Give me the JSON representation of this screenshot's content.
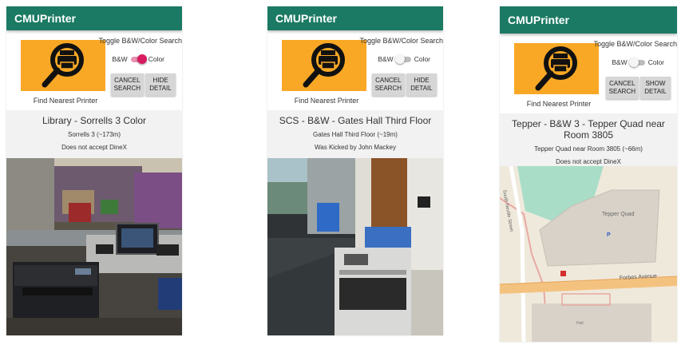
{
  "screens": [
    {
      "app_title": "CMUPrinter",
      "find_label": "Find Nearest Printer",
      "toggle_title": "Toggle B&W/Color Search",
      "bw_label": "B&W",
      "color_label": "Color",
      "toggle_state": "Color",
      "cancel_label": "CANCEL\nSEARCH",
      "detail_label": "HIDE\nDETAIL",
      "printer_name": "Library - Sorrells 3 Color",
      "location": "Sorrells 3 (~173m)",
      "note": "Does not accept DineX",
      "image": "photo of color printer near library desk"
    },
    {
      "app_title": "CMUPrinter",
      "find_label": "Find Nearest Printer",
      "toggle_title": "Toggle B&W/Color Search",
      "bw_label": "B&W",
      "color_label": "Color",
      "toggle_state": "B&W",
      "cancel_label": "CANCEL\nSEARCH",
      "detail_label": "HIDE\nDETAIL",
      "printer_name": "SCS - B&W - Gates Hall Third Floor",
      "location": "Gates Hall Third Floor (~19m)",
      "note": "Was Kicked by John Mackey",
      "image": "photo of printer in hallway with recycling bins"
    },
    {
      "app_title": "CMUPrinter",
      "find_label": "Find Nearest Printer",
      "toggle_title": "Toggle B&W/Color Search",
      "bw_label": "B&W",
      "color_label": "Color",
      "toggle_state": "B&W",
      "cancel_label": "CANCEL\nSEARCH",
      "detail_label": "SHOW\nDETAIL",
      "printer_name": "Tepper - B&W 3 - Tepper Quad near Room 3805",
      "location": "Tepper Quad near Room 3805 (~66m)",
      "note": "Does not accept DineX",
      "image": "map of Tepper Quad area",
      "map_labels": {
        "street_left": "South Neville Street",
        "building": "Tepper Quad",
        "marker": "P",
        "avenue": "Forbes Avenue",
        "bottom": "Hall"
      }
    }
  ],
  "colors": {
    "appbar": "#1b7a63",
    "search_bg": "#f9a825",
    "toggle_on": "#d81b60",
    "button_bg": "#d6d6d6",
    "panel_bg": "#f2f2f2"
  },
  "icons": {
    "search": "magnifier-printer-icon"
  }
}
